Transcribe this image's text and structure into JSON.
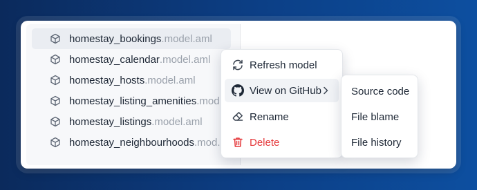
{
  "files": [
    {
      "name": "homestay_bookings",
      "ext": ".model.aml",
      "icon": "cube-icon",
      "active": true
    },
    {
      "name": "homestay_calendar",
      "ext": ".model.aml",
      "icon": "cube-icon",
      "active": false
    },
    {
      "name": "homestay_hosts",
      "ext": ".model.aml",
      "icon": "cube-icon",
      "active": false
    },
    {
      "name": "homestay_listing_amenities",
      "ext": ".mod...",
      "icon": "cube-icon",
      "active": false
    },
    {
      "name": "homestay_listings",
      "ext": ".model.aml",
      "icon": "cube-icon",
      "active": false
    },
    {
      "name": "homestay_neighbourhoods",
      "ext": ".mod...",
      "icon": "cube-icon",
      "active": false
    }
  ],
  "context_menu": {
    "refresh": {
      "label": "Refresh model",
      "icon": "refresh-icon"
    },
    "github": {
      "label": "View on GitHub",
      "icon": "github-icon"
    },
    "rename": {
      "label": "Rename",
      "icon": "eraser-icon"
    },
    "delete": {
      "label": "Delete",
      "icon": "trash-icon",
      "color": "#e5383b"
    }
  },
  "submenu": {
    "source_code": "Source code",
    "file_blame": "File blame",
    "file_history": "File history"
  },
  "colors": {
    "background_start": "#0b2a5c",
    "background_end": "#0d4fa0",
    "danger": "#e5383b"
  }
}
